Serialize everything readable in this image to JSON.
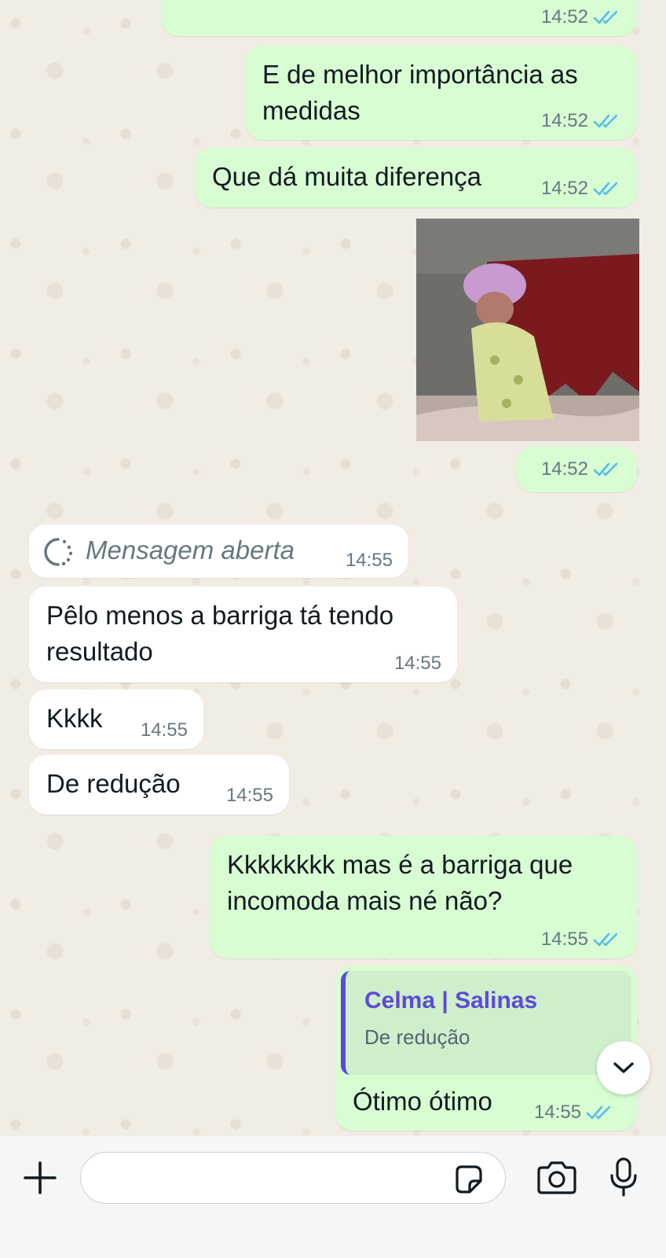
{
  "messages": [
    {
      "text": "",
      "time": "14:52",
      "direction": "out"
    },
    {
      "text": "E de melhor importância as medidas",
      "time": "14:52",
      "direction": "out"
    },
    {
      "text": "Que dá muita diferença",
      "time": "14:52",
      "direction": "out"
    },
    {
      "text": "",
      "time": "14:52",
      "direction": "out",
      "kind": "image"
    },
    {
      "text": "Mensagem aberta",
      "time": "14:55",
      "direction": "in",
      "kind": "view-once-opened"
    },
    {
      "text": "Pêlo menos a barriga tá tendo resultado",
      "time": "14:55",
      "direction": "in"
    },
    {
      "text": "Kkkk",
      "time": "14:55",
      "direction": "in"
    },
    {
      "text": "De redução",
      "time": "14:55",
      "direction": "in"
    },
    {
      "text": "Kkkkkkkk mas é a barriga que incomoda mais né não?",
      "time": "14:55",
      "direction": "out"
    },
    {
      "text": "Ótimo ótimo",
      "time": "14:55",
      "direction": "out",
      "reply_to": {
        "name": "Celma | Salinas",
        "text": "De redução"
      }
    }
  ],
  "composer": {
    "placeholder": ""
  },
  "icons": {
    "attach": "plus-icon",
    "sticker": "sticker-icon",
    "camera": "camera-icon",
    "mic": "microphone-icon",
    "scroll": "chevron-down-icon",
    "read": "double-check-icon"
  },
  "colors": {
    "outgoing": "#d9fdd3",
    "incoming": "#ffffff",
    "read_ticks": "#53bdeb",
    "reply_accent": "#5b4ad9"
  }
}
